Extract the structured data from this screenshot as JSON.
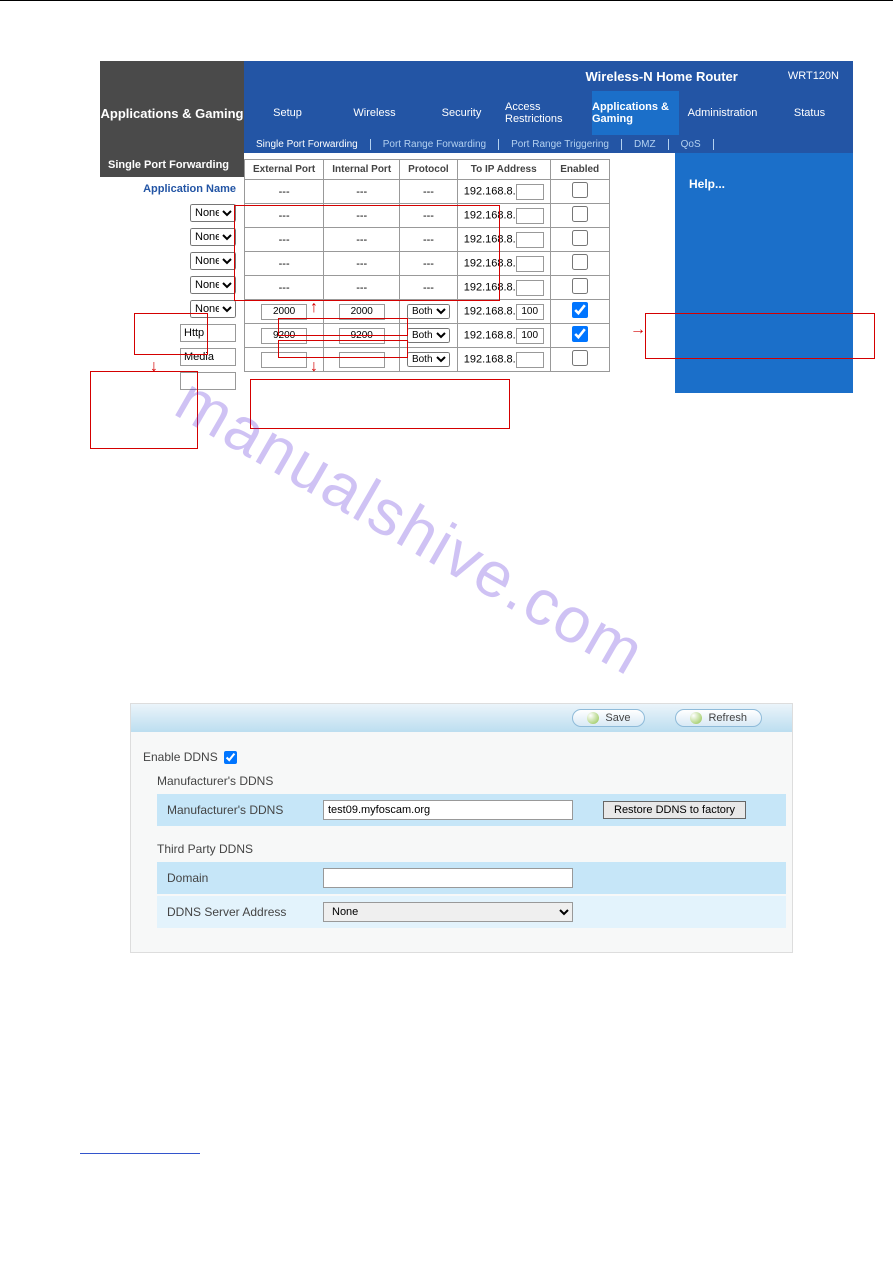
{
  "router": {
    "header_title": "Wireless-N Home Router",
    "model": "WRT120N",
    "section": "Applications & Gaming",
    "tabs": [
      "Setup",
      "Wireless",
      "Security",
      "Access Restrictions",
      "Applications & Gaming",
      "Administration",
      "Status"
    ],
    "subtabs": [
      "Single Port Forwarding",
      "Port Range Forwarding",
      "Port Range Triggering",
      "DMZ",
      "QoS"
    ],
    "sidebar_title": "Single Port Forwarding",
    "app_name_label": "Application Name",
    "cols": {
      "ext": "External Port",
      "int": "Internal Port",
      "proto": "Protocol",
      "to_ip": "To IP Address",
      "enabled": "Enabled"
    },
    "none_option": "None",
    "dash": "---",
    "rows_none_count": 5,
    "ip_prefix": "192.168.8.",
    "custom_rows": [
      {
        "name": "Http",
        "ext": "2000",
        "int": "2000",
        "proto": "Both",
        "ip": "100",
        "enabled": true
      },
      {
        "name": "Media",
        "ext": "9200",
        "int": "9200",
        "proto": "Both",
        "ip": "100",
        "enabled": true
      },
      {
        "name": "",
        "ext": "",
        "int": "",
        "proto": "Both",
        "ip": "",
        "enabled": false
      }
    ],
    "help_label": "Help..."
  },
  "ddns": {
    "btn_save": "Save",
    "btn_refresh": "Refresh",
    "enable_label": "Enable DDNS",
    "enabled": true,
    "mfr_section": "Manufacturer's DDNS",
    "mfr_label": "Manufacturer's DDNS",
    "mfr_value": "test09.myfoscam.org",
    "restore_label": "Restore DDNS to factory",
    "third_section": "Third Party DDNS",
    "domain_label": "Domain",
    "domain_value": "",
    "server_label": "DDNS Server Address",
    "server_value": "None"
  },
  "watermark": "manualshive.com"
}
